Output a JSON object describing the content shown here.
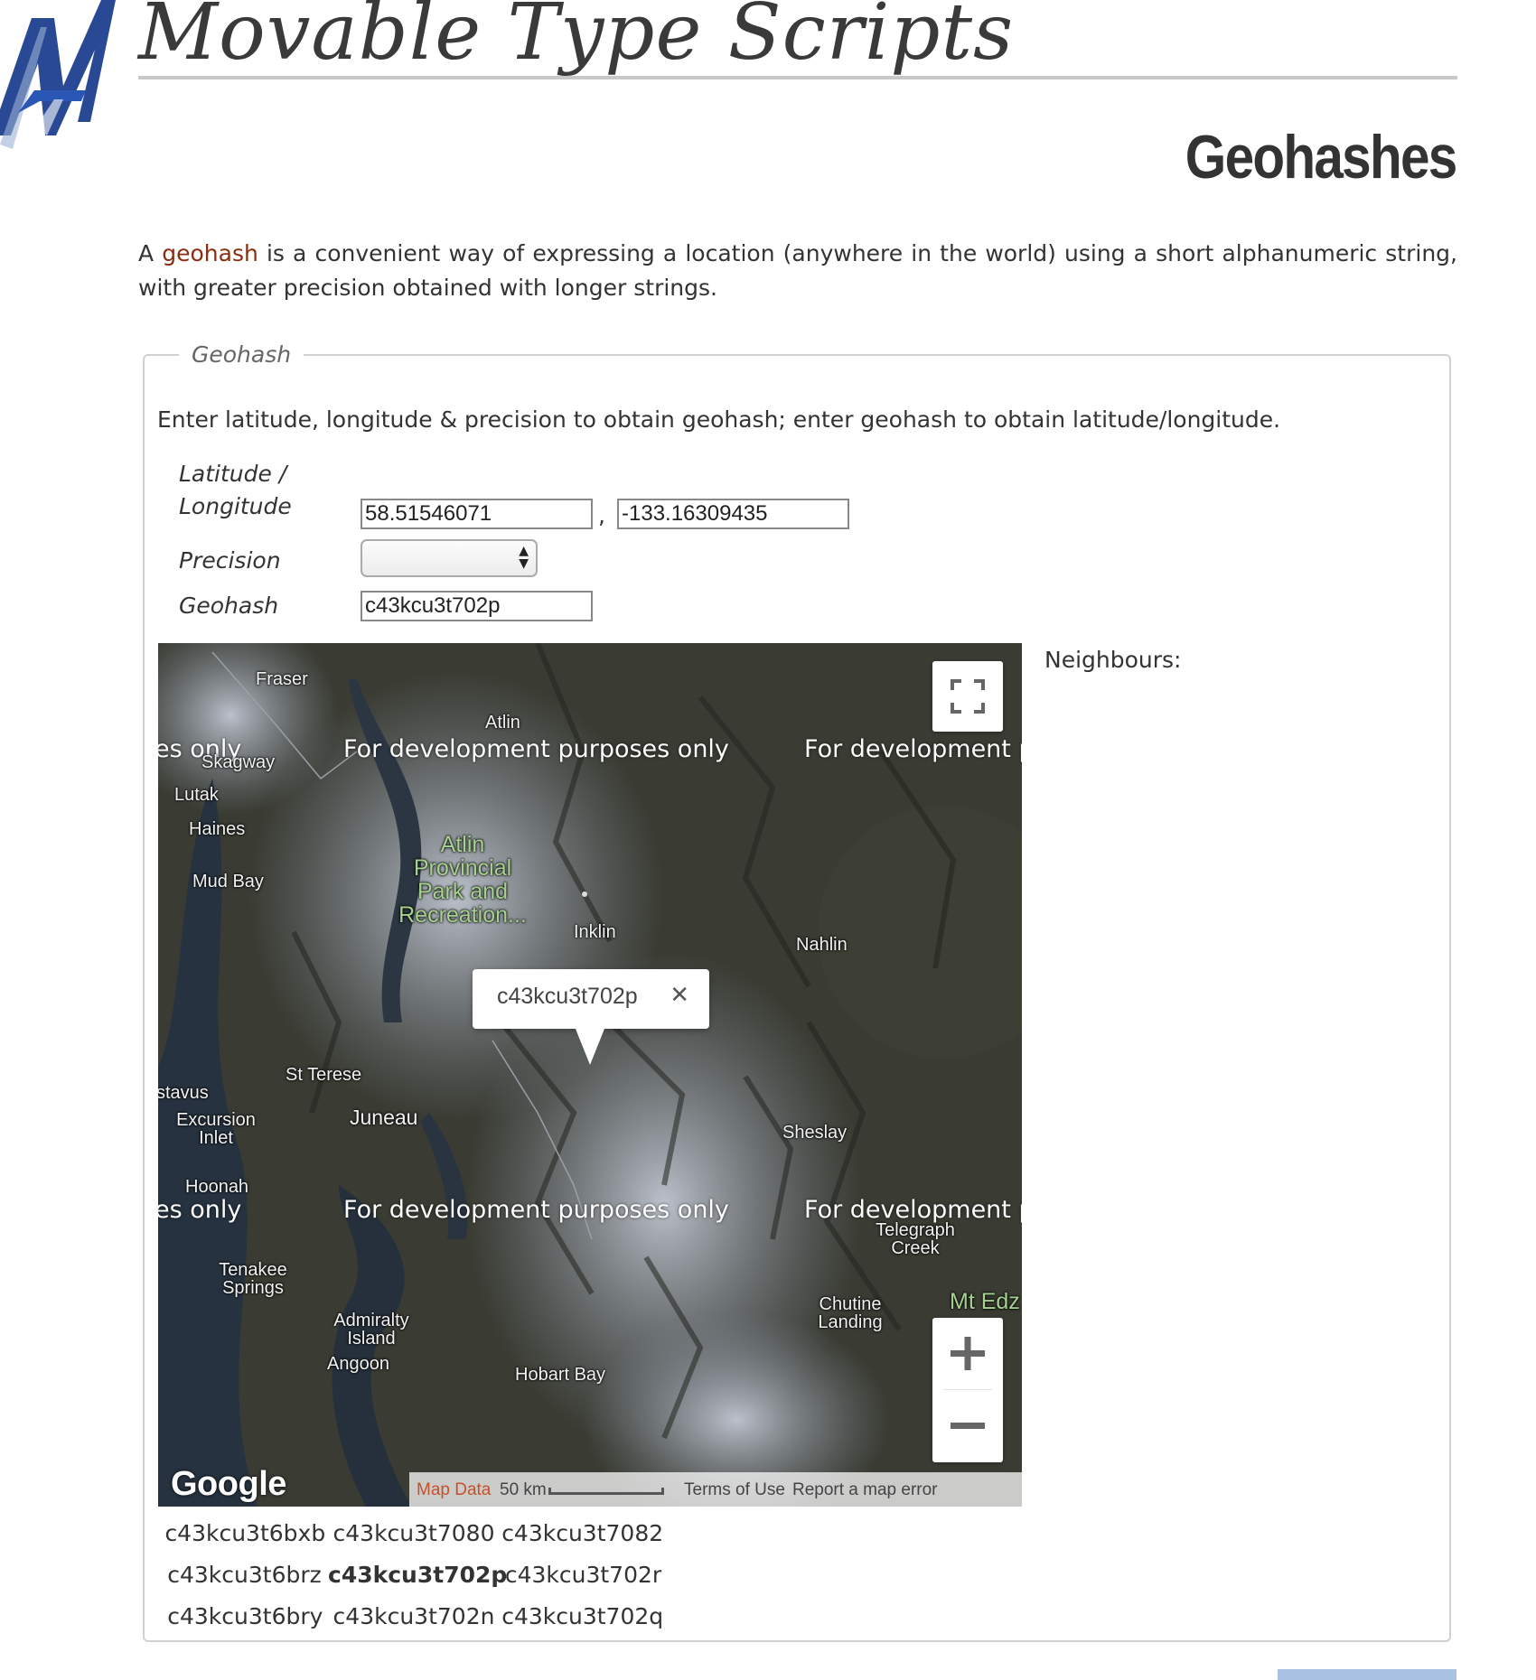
{
  "header": {
    "site_title": "Movable Type Scripts",
    "page_heading": "Geohashes"
  },
  "intro": {
    "prefix": "A",
    "link_text": "geohash",
    "suffix": "is a convenient way of expressing a location (anywhere in the world) using a short alphanumeric string, with greater precision obtained with longer strings."
  },
  "form": {
    "legend": "Geohash",
    "instructions": "Enter latitude, longitude & precision to obtain geohash; enter geohash to obtain latitude/longitude.",
    "latlon_label_line1": "Latitude /",
    "latlon_label_line2": "Longitude",
    "latitude_value": "58.51546071",
    "longitude_value": "-133.16309435",
    "separator": ",",
    "precision_label": "Precision",
    "precision_value": "",
    "geohash_label": "Geohash",
    "geohash_value": "c43kcu3t702p"
  },
  "map": {
    "popup_text": "c43kcu3t702p",
    "watermark": "For development purposes only",
    "watermark_partial": "es only",
    "watermark_cut": "For development pu",
    "places": {
      "fraser": "Fraser",
      "atlin": "Atlin",
      "skagway": "Skagway",
      "lutak": "Lutak",
      "haines": "Haines",
      "mud_bay": "Mud Bay",
      "atlin_park_1": "Atlin",
      "atlin_park_2": "Provincial",
      "atlin_park_3": "Park and",
      "atlin_park_4": "Recreation...",
      "inklin": "Inklin",
      "nahlin": "Nahlin",
      "st_terese": "St Terese",
      "gustavus": "stavus",
      "excursion_inlet_1": "Excursion",
      "excursion_inlet_2": "Inlet",
      "juneau": "Juneau",
      "sheslay": "Sheslay",
      "hoonah": "Hoonah",
      "telegraph_creek_1": "Telegraph",
      "telegraph_creek_2": "Creek",
      "tenakee_1": "Tenakee",
      "tenakee_2": "Springs",
      "chutine_1": "Chutine",
      "chutine_2": "Landing",
      "mt_edz": "Mt Edz",
      "admiralty_1": "Admiralty",
      "admiralty_2": "Island",
      "angoon": "Angoon",
      "hobart_bay": "Hobart Bay"
    },
    "google_logo": "Google",
    "attribution": {
      "map_data": "Map Data",
      "scale": "50 km",
      "terms": "Terms of Use",
      "report": "Report a map error"
    },
    "colors": {
      "map_data_link": "#c5502a"
    }
  },
  "neighbours": {
    "label": "Neighbours:",
    "rows": [
      [
        "c43kcu3t6bxb",
        "c43kcu3t7080",
        "c43kcu3t7082"
      ],
      [
        "c43kcu3t6brz",
        "c43kcu3t702p",
        "c43kcu3t702r"
      ],
      [
        "c43kcu3t6bry",
        "c43kcu3t702n",
        "c43kcu3t702q"
      ]
    ]
  },
  "colors": {
    "link": "#8a2e10",
    "logo_blue": "#1d3f8f"
  }
}
